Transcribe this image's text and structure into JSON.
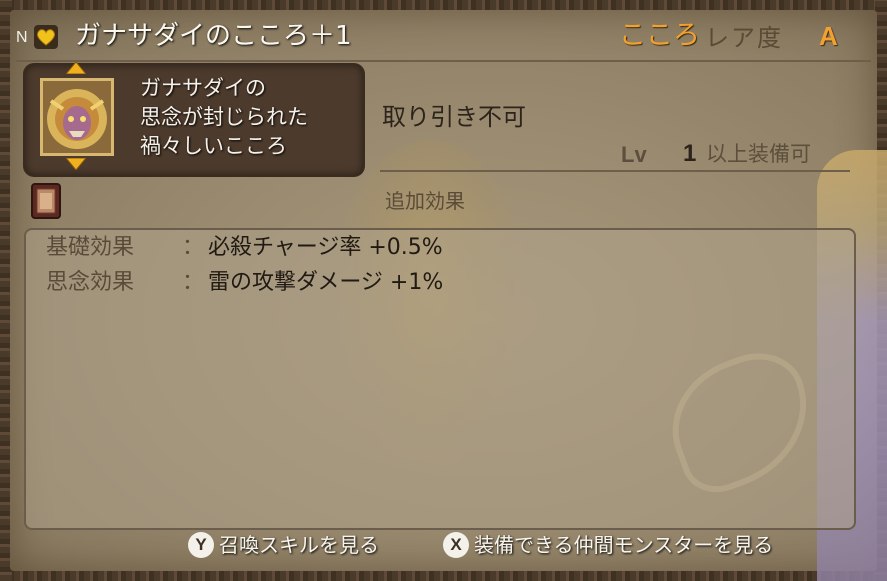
{
  "header": {
    "n_marker": "N",
    "item_name": "ガナサダイのこころ＋1",
    "category": "こころ",
    "rarity_label": "レア度",
    "rarity_value": "A"
  },
  "description": {
    "lines": [
      "ガナサダイの",
      "思念が封じられた",
      "禍々しいこころ"
    ]
  },
  "trade_status": "取り引き不可",
  "level": {
    "label": "Lv",
    "value": "1",
    "suffix": "以上装備可"
  },
  "effects_section": {
    "title": "追加効果",
    "items": [
      {
        "label": "基礎効果",
        "separator": "：",
        "value": "必殺チャージ率 +0.5%"
      },
      {
        "label": "思念効果",
        "separator": "：",
        "value": "雷の攻撃ダメージ +1%"
      }
    ]
  },
  "buttons": {
    "y": {
      "key": "Y",
      "label": "召喚スキルを見る"
    },
    "x": {
      "key": "X",
      "label": "装備できる仲間モンスターを見る"
    }
  },
  "colors": {
    "accent_orange": "#f2a030",
    "heart_gold": "#f2c21c",
    "panel_brown": "#4c3a2c"
  },
  "icons": [
    "heart-icon",
    "up-arrow-icon",
    "down-arrow-icon",
    "monster-portrait-icon",
    "book-icon"
  ]
}
